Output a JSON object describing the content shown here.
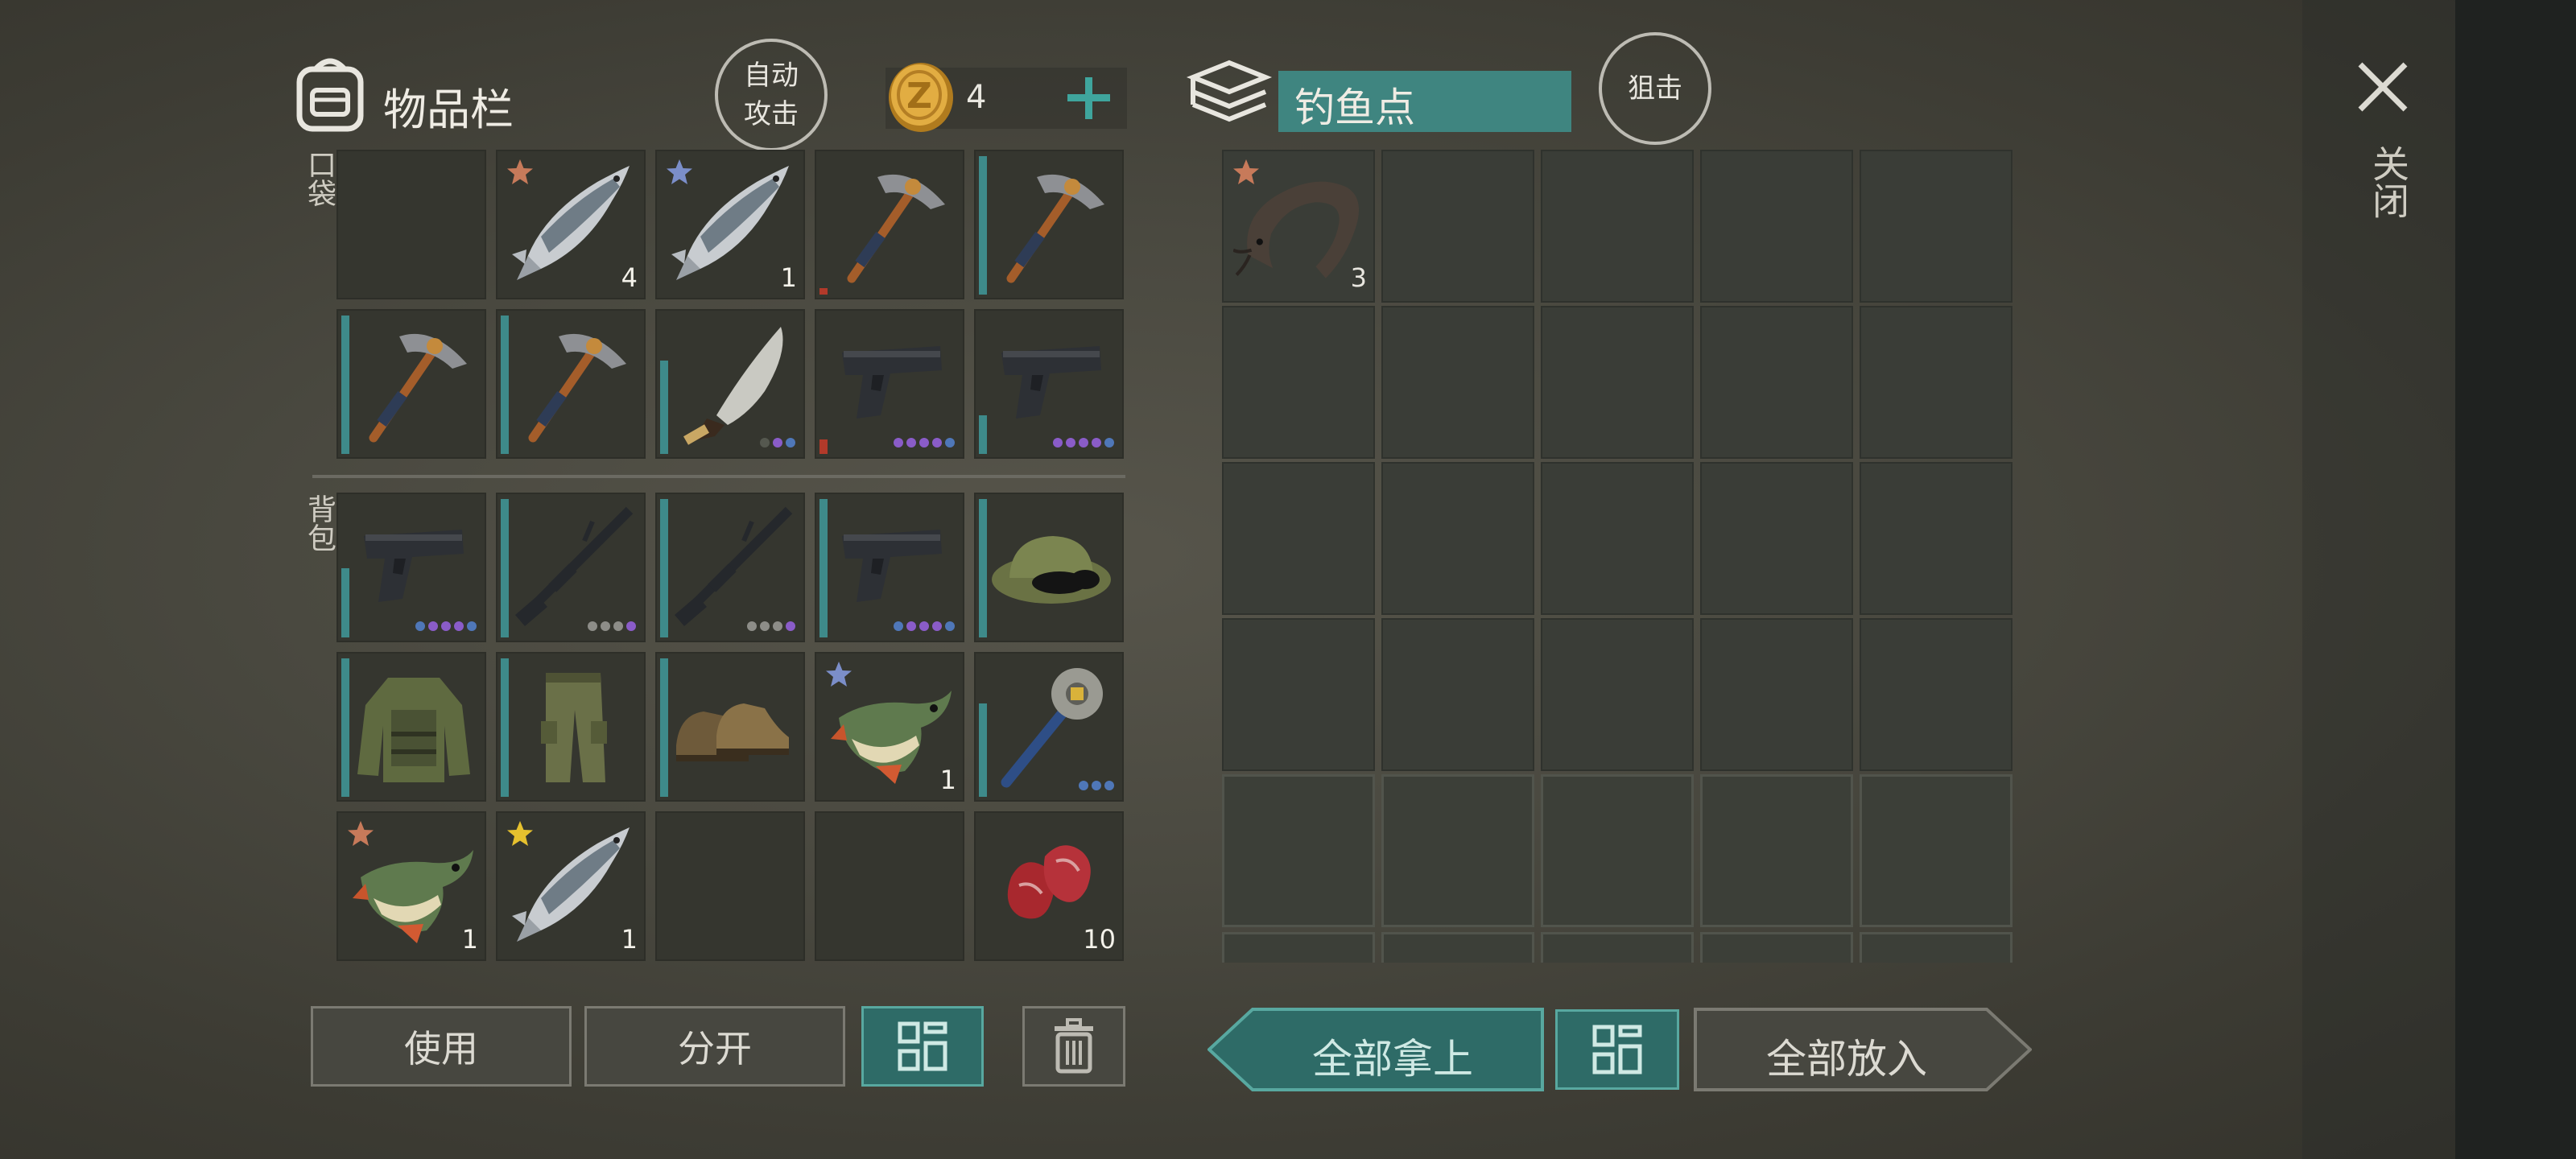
{
  "header": {
    "inventory_title": "物品栏",
    "auto_attack": [
      "自动",
      "攻击"
    ],
    "coin_count": "4",
    "container_title": "钓鱼点",
    "snipe": "狙击",
    "close_label": "关闭"
  },
  "sections": {
    "pocket": "口袋",
    "backpack": "背包"
  },
  "pocket_slots": [
    {
      "item": "empty"
    },
    {
      "item": "salmon",
      "count": "4",
      "star": "bronze"
    },
    {
      "item": "salmon",
      "count": "1",
      "star": "silver"
    },
    {
      "item": "pickaxe"
    },
    {
      "item": "pickaxe"
    },
    {
      "item": "pickaxe"
    },
    {
      "item": "pickaxe"
    },
    {
      "item": "machete"
    },
    {
      "item": "pistol"
    },
    {
      "item": "pistol"
    }
  ],
  "backpack_slots": [
    {
      "item": "pistol"
    },
    {
      "item": "rifle"
    },
    {
      "item": "rifle"
    },
    {
      "item": "pistol"
    },
    {
      "item": "camo-hat"
    },
    {
      "item": "camo-jacket"
    },
    {
      "item": "camo-pants"
    },
    {
      "item": "boots"
    },
    {
      "item": "pike",
      "count": "1",
      "star": "silver"
    },
    {
      "item": "saw-mace"
    },
    {
      "item": "pike",
      "count": "1",
      "star": "bronze"
    },
    {
      "item": "salmon",
      "count": "1",
      "star": "gold"
    },
    {
      "item": "empty"
    },
    {
      "item": "empty"
    },
    {
      "item": "raw-meat",
      "count": "10"
    }
  ],
  "container_slots": [
    {
      "item": "catfish",
      "count": "3",
      "star": "bronze"
    }
  ],
  "buttons": {
    "use": "使用",
    "split": "分开",
    "take_all": "全部拿上",
    "put_all": "全部放入"
  },
  "colors": {
    "teal_accent": "#2e6b67",
    "teal_bar": "#3e8a8a",
    "purple_dot": "#8a5cc8",
    "blue_dot": "#4f77b8",
    "grey_dot": "#8d8d88",
    "coin": "#d9a53a"
  }
}
